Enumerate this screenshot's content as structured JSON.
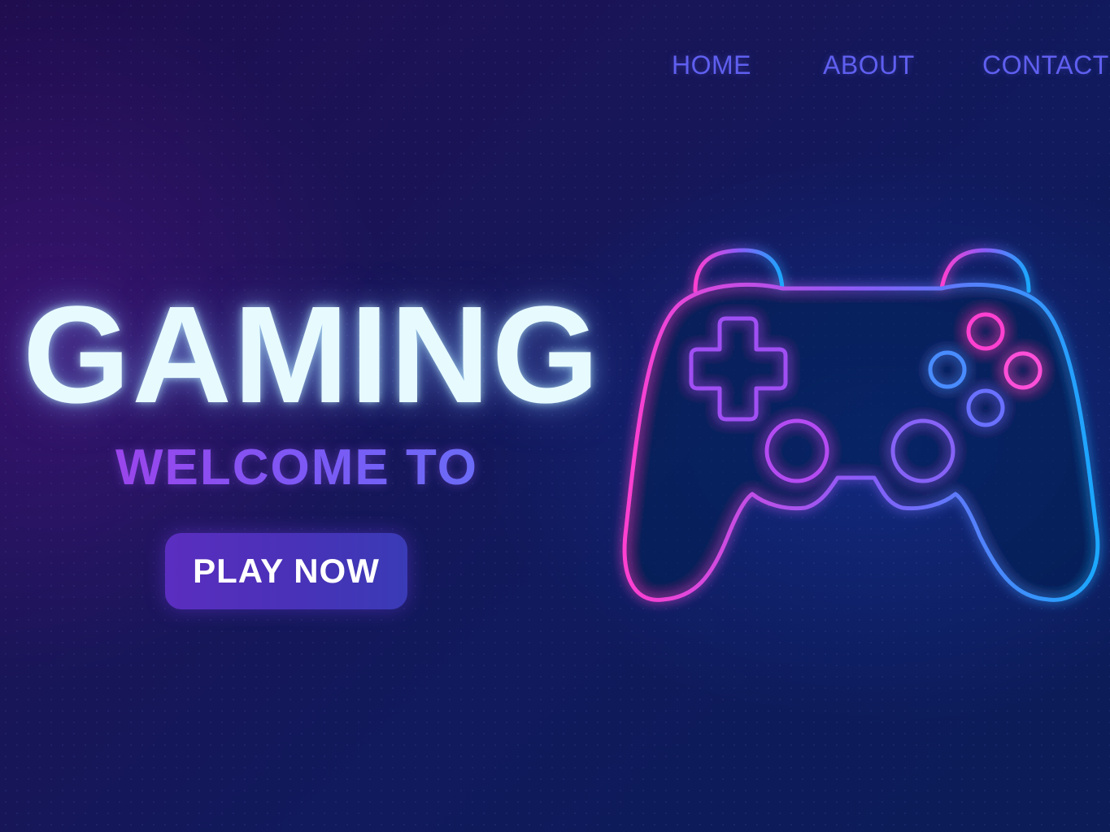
{
  "nav": {
    "home": "HOME",
    "about": "ABOUT",
    "contact": "CONTACT"
  },
  "hero": {
    "title": "GAMING",
    "subtitle": "WELCOME TO",
    "cta_label": "PLAY NOW"
  },
  "illustration": {
    "icon": "gamepad-icon"
  },
  "colors": {
    "background": "#121659",
    "nav_text": "#5f5ff0",
    "title_text": "#e7fbff",
    "subtitle_gradient_start": "#9a45ec",
    "subtitle_gradient_end": "#6a6df7",
    "button": "#4a31b8",
    "neon_pink": "#ff3fd0",
    "neon_violet": "#8a5cf8",
    "neon_cyan": "#1aa8ff"
  }
}
